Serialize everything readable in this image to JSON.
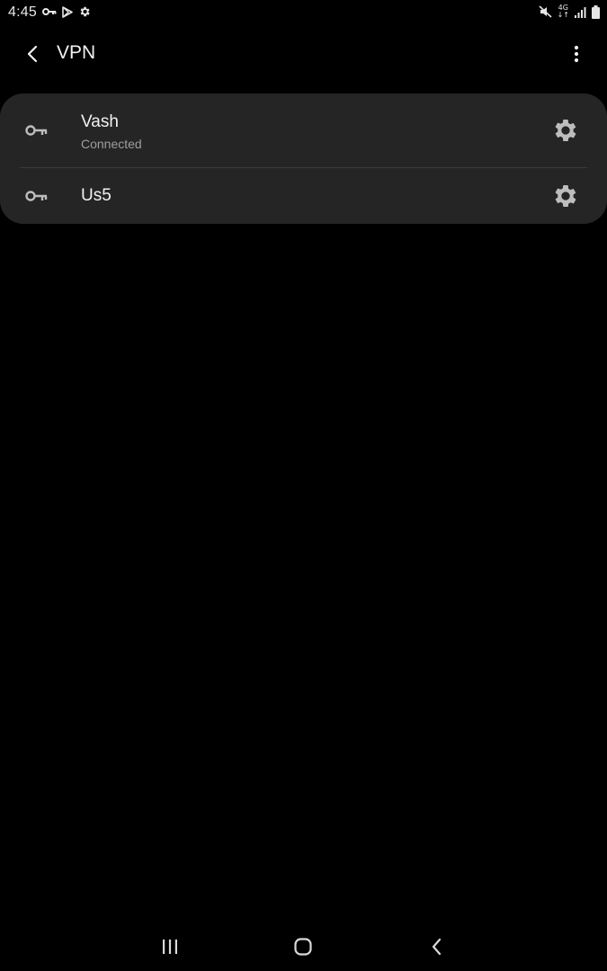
{
  "status_bar": {
    "time": "4:45",
    "network_top": "4G",
    "network_bottom": "↓↑",
    "left_icons": [
      "vpn-key-icon",
      "play-store-icon",
      "settings-gear-icon"
    ],
    "right_icons": [
      "mute-icon",
      "network-type-icon",
      "signal-icon",
      "battery-icon"
    ]
  },
  "app_bar": {
    "title": "VPN",
    "back_icon": "chevron-left-icon",
    "more_icon": "more-vert-icon"
  },
  "vpn_list": [
    {
      "name": "Vash",
      "status": "Connected",
      "icon": "vpn-key-icon",
      "action_icon": "gear-icon"
    },
    {
      "name": "Us5",
      "status": "",
      "icon": "vpn-key-icon",
      "action_icon": "gear-icon"
    }
  ],
  "nav_bar": {
    "icons": [
      "recents-icon",
      "home-icon",
      "back-icon"
    ]
  },
  "colors": {
    "background": "#000000",
    "card": "#252525",
    "text_primary": "#f2f2f2",
    "text_secondary": "#9e9e9e",
    "icon": "#bdbdbd"
  }
}
